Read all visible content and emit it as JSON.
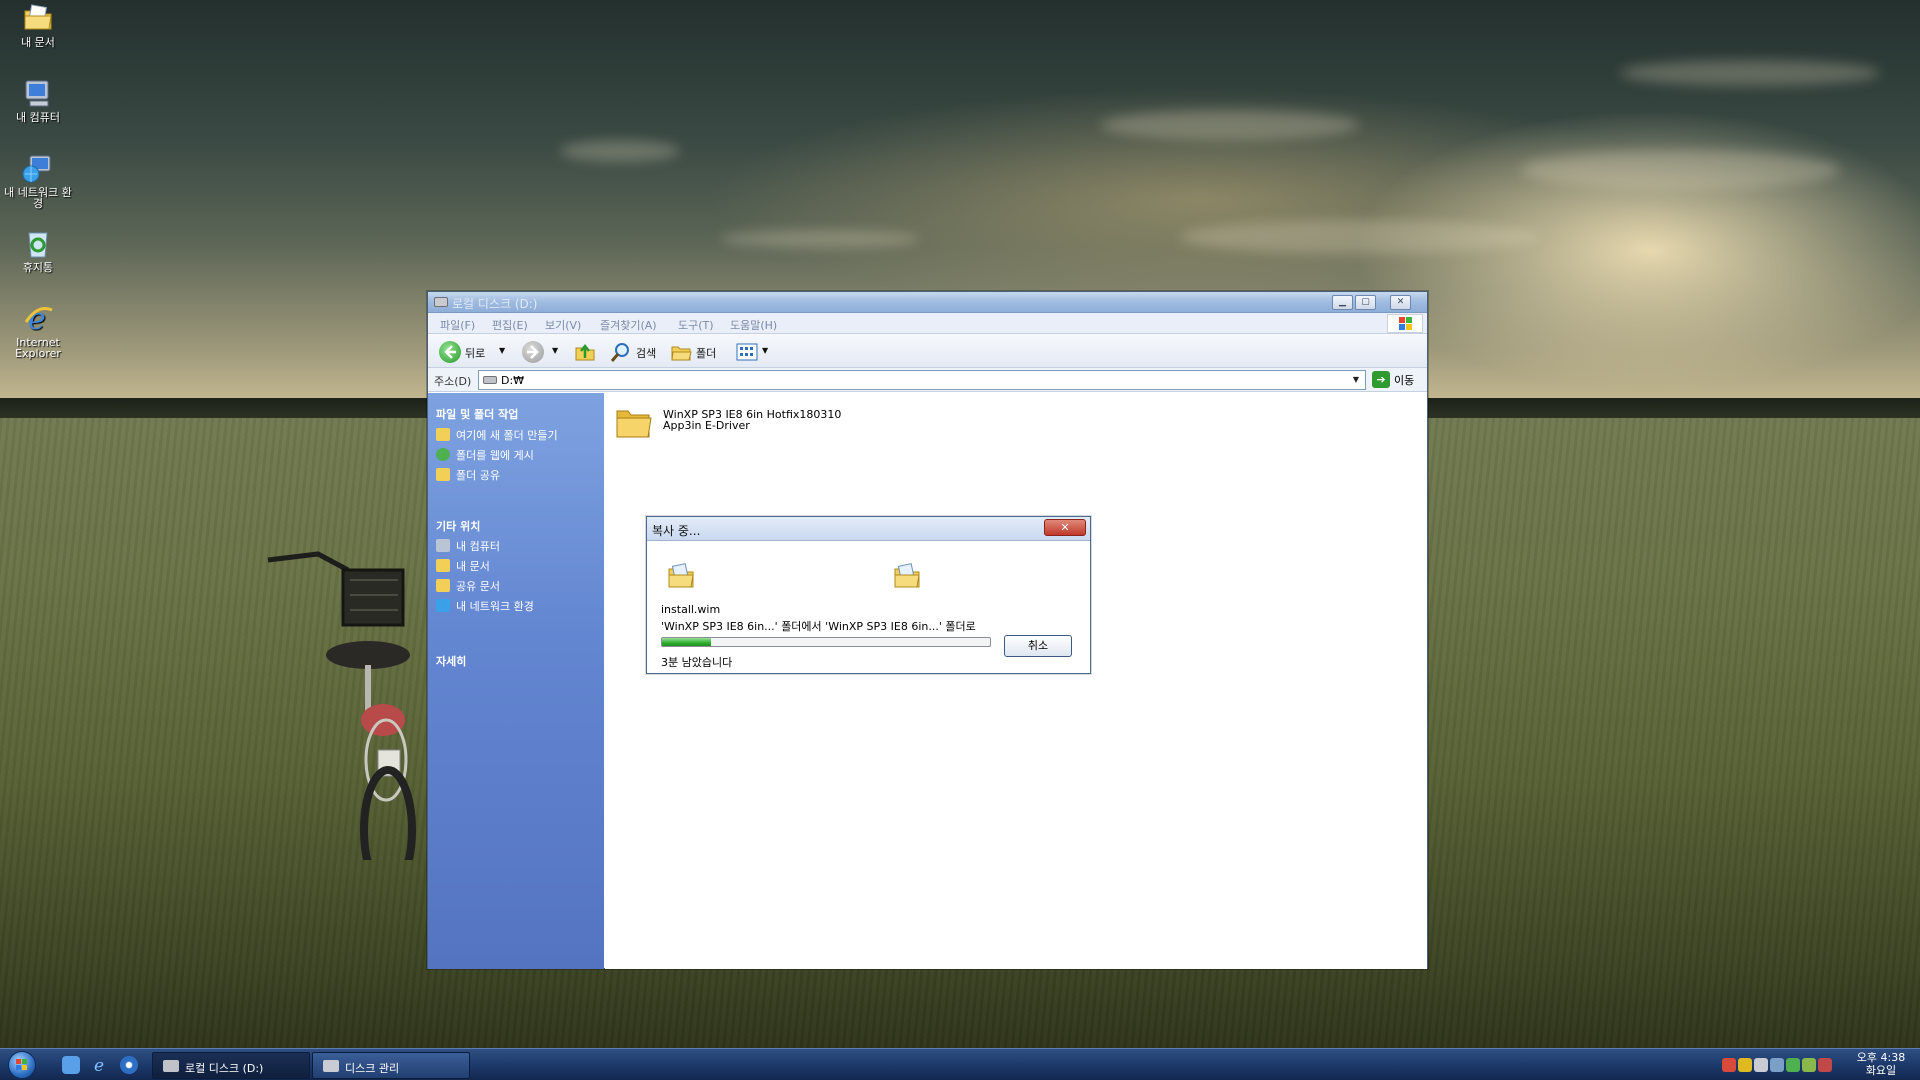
{
  "desktop": {
    "icons": [
      {
        "label": "내 문서",
        "icon": "my-documents-icon"
      },
      {
        "label": "내 컴퓨터",
        "icon": "my-computer-icon"
      },
      {
        "label": "내 네트워크 환경",
        "icon": "network-places-icon"
      },
      {
        "label": "휴지통",
        "icon": "recycle-bin-icon"
      },
      {
        "label": "Internet Explorer",
        "icon": "internet-explorer-icon"
      }
    ]
  },
  "explorer": {
    "title": "로컬 디스크 (D:)",
    "menu": [
      "파일(F)",
      "편집(E)",
      "보기(V)",
      "즐겨찾기(A)",
      "도구(T)",
      "도움말(H)"
    ],
    "toolbar": {
      "back": "뒤로",
      "search": "검색",
      "folders": "폴더"
    },
    "address": {
      "label": "주소(D)",
      "value": "D:₩",
      "go": "이동"
    },
    "sidebar": {
      "tasks_heading": "파일 및 폴더 작업",
      "tasks": [
        "여기에 새 폴더 만들기",
        "폴더를 웹에 게시",
        "폴더 공유"
      ],
      "places_heading": "기타 위치",
      "places": [
        "내 컴퓨터",
        "내 문서",
        "공유 문서",
        "내 네트워크 환경"
      ],
      "details_heading": "자세히"
    },
    "items": [
      {
        "name_line1": "WinXP SP3 IE8 6in Hotfix180310",
        "name_line2": "App3in E-Driver"
      }
    ]
  },
  "copy_dialog": {
    "title": "복사 중...",
    "filename": "install.wim",
    "path": "'WinXP SP3 IE8 6in...' 폴더에서 'WinXP SP3 IE8 6in...' 폴더로",
    "progress": 0.15,
    "remaining": "3분 남았습니다",
    "cancel": "취소"
  },
  "taskbar": {
    "tasks": [
      "로컬 디스크 (D:)",
      "디스크 관리"
    ],
    "clock": {
      "time": "오후 4:38",
      "day": "화요일"
    }
  },
  "colors": {
    "sidebar_top": "#7ea2e0",
    "sidebar_bottom": "#5474c2",
    "taskbar": "#1d3a6b",
    "progress": "#2fae2f"
  }
}
